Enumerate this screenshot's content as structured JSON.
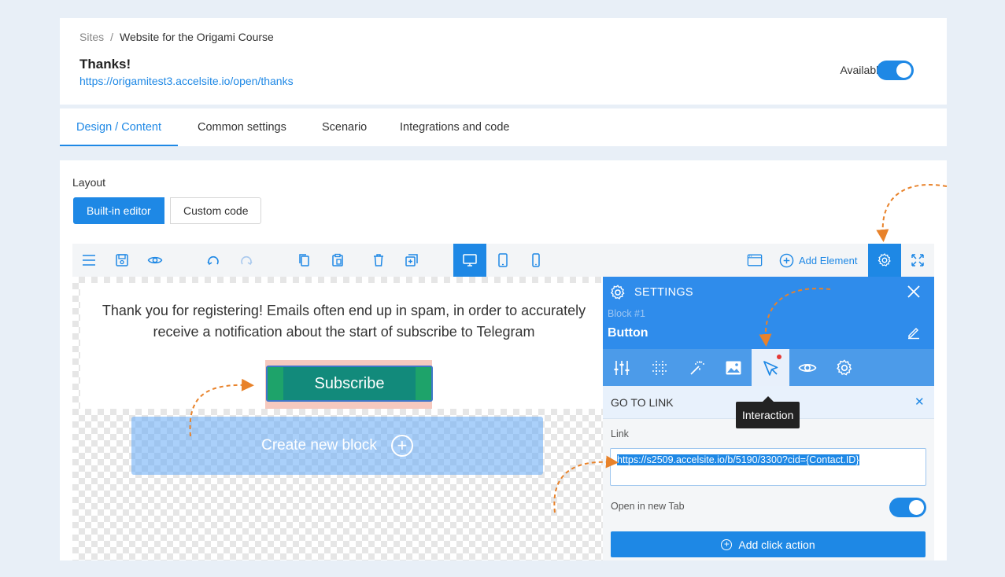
{
  "breadcrumb": {
    "root": "Sites",
    "separator": "/",
    "current": "Website for the Origami Course"
  },
  "page": {
    "title": "Thanks!",
    "url": "https://origamitest3.accelsite.io/open/thanks"
  },
  "availability": {
    "label": "Available",
    "enabled": true
  },
  "tabs": [
    {
      "label": "Design / Content",
      "active": true
    },
    {
      "label": "Common settings",
      "active": false
    },
    {
      "label": "Scenario",
      "active": false
    },
    {
      "label": "Integrations and code",
      "active": false
    }
  ],
  "layout": {
    "label": "Layout",
    "builtin": "Built-in editor",
    "custom": "Custom code",
    "selected": "builtin"
  },
  "toolbar": {
    "add_element": "Add Element",
    "active_device": "desktop"
  },
  "canvas": {
    "message": "Thank you for registering! Emails often end up in spam, in order to accurately receive a notification about the start of subscribe to Telegram",
    "subscribe_button": "Subscribe",
    "create_block": "Create new block"
  },
  "settings": {
    "title": "SETTINGS",
    "block_label": "Block #1",
    "element_name": "Button",
    "section_title": "GO TO LINK",
    "tooltip": "Interaction",
    "link_label": "Link",
    "link_value": "https://s2509.accelsite.io/b/5190/3300?cid={Contact.ID}",
    "new_tab_label": "Open in new Tab",
    "new_tab_enabled": true,
    "add_click_action": "Add click action"
  },
  "colors": {
    "accent": "#1e88e5",
    "panel_header": "#2f8ceb",
    "subscribe_bg": "#128a7b",
    "annotation": "#e8822a"
  }
}
